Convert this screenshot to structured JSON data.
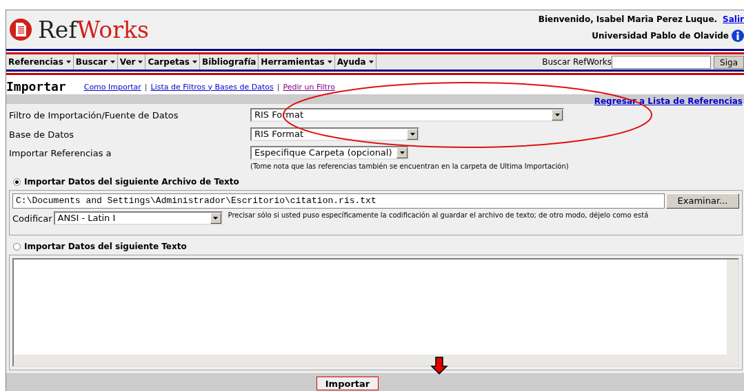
{
  "header": {
    "logo_first": "Ref",
    "logo_second": "Works",
    "welcome": "Bienvenido, Isabel Maria Perez Luque.",
    "logout": "Salir",
    "institution": "Universidad Pablo de Olavide"
  },
  "menu": [
    {
      "label": "Referencias",
      "has_dropdown": true
    },
    {
      "label": "Buscar",
      "has_dropdown": true
    },
    {
      "label": "Ver",
      "has_dropdown": true
    },
    {
      "label": "Carpetas",
      "has_dropdown": true
    },
    {
      "label": "Bibliografía",
      "has_dropdown": false
    },
    {
      "label": "Herramientas",
      "has_dropdown": true
    },
    {
      "label": "Ayuda",
      "has_dropdown": true
    }
  ],
  "search": {
    "label": "Buscar RefWorks",
    "button": "Siga"
  },
  "page": {
    "title": "Importar",
    "separator": "|",
    "links": [
      {
        "label": "Como Importar",
        "visited": false
      },
      {
        "label": "Lista de Filtros y Bases de Datos",
        "visited": false
      },
      {
        "label": "Pedir un Filtro",
        "visited": true
      }
    ],
    "back_link": "Regresar a Lista de Referencias"
  },
  "fields": [
    {
      "label": "Filtro de Importación/Fuente de Datos",
      "value": "RIS Format"
    },
    {
      "label": "Base de Datos",
      "value": "RIS Format"
    },
    {
      "label": "Importar Referencias a",
      "value": "Especifique Carpeta (opcional)"
    }
  ],
  "note": "(Tome nota que las referencias también se encuentran en la carpeta de Ultima Importación)",
  "file_source": {
    "label": "Importar Datos del siguiente Archivo de Texto",
    "selected": true,
    "path": "C:\\Documents and Settings\\Administrador\\Escritorio\\citation.ris.txt",
    "browse": "Examinar...",
    "encoding_label": "Codificar",
    "encoding": "ANSI - Latin I",
    "encoding_note": "Precisar sólo si usted puso específicamente la codificación al guardar el archivo de texto; de otro modo, déjelo como está"
  },
  "text_source": {
    "label": "Importar Datos del siguiente Texto",
    "selected": false
  },
  "submit": "Importar"
}
